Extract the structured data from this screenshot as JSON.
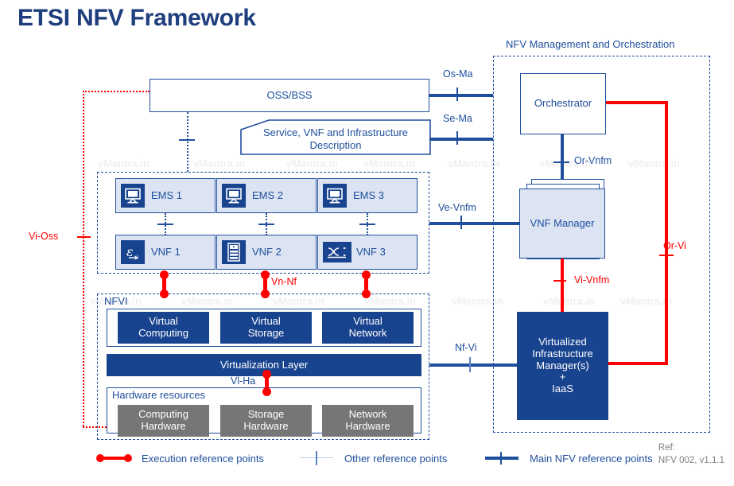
{
  "page": {
    "title": "ETSI NFV Framework",
    "watermark": "vMantra.in",
    "reference_note_line1": "Ref:",
    "reference_note_line2": "NFV 002, v1.1.1"
  },
  "colors": {
    "dark_blue": "#18438E",
    "title_blue": "#1F3E7E",
    "outline_blue": "#1F4E9C",
    "light_blue_fill": "#DCE4F3",
    "gray_fill": "#767676",
    "red": "#FF0000",
    "note_gray": "#7F7F7F"
  },
  "oss": {
    "label": "OSS/BSS"
  },
  "description_box": {
    "line1": "Service, VNF  and Infrastructure",
    "line2": "Description"
  },
  "vnf_layer": {
    "ems": [
      {
        "label": "EMS 1",
        "icon": "monitor-icon"
      },
      {
        "label": "EMS 2",
        "icon": "monitor-icon"
      },
      {
        "label": "EMS 3",
        "icon": "monitor-icon"
      }
    ],
    "vnfs": [
      {
        "label": "VNF 1",
        "icon": "epsilon-icon"
      },
      {
        "label": "VNF 2",
        "icon": "server-icon"
      },
      {
        "label": "VNF 3",
        "icon": "switch-icon"
      }
    ]
  },
  "nfvi": {
    "label": "NFVI",
    "virtual_resources": [
      {
        "line1": "Virtual",
        "line2": "Computing"
      },
      {
        "line1": "Virtual",
        "line2": "Storage"
      },
      {
        "line1": "Virtual",
        "line2": "Network"
      }
    ],
    "virtualization_layer": "Virtualization Layer",
    "hardware_label": "Hardware  resources",
    "hardware_resources": [
      {
        "line1": "Computing",
        "line2": "Hardware"
      },
      {
        "line1": "Storage",
        "line2": "Hardware"
      },
      {
        "line1": "Network",
        "line2": "Hardware"
      }
    ]
  },
  "mano": {
    "title": "NFV Management and Orchestration",
    "orchestrator": "Orchestrator",
    "vnf_manager": "VNF Manager",
    "vim_line1": "Virtualized",
    "vim_line2": "Infrastructure",
    "vim_line3": "Manager(s)",
    "vim_line4": "+",
    "vim_line5": "IaaS"
  },
  "reference_points": {
    "os_ma": "Os-Ma",
    "se_ma": "Se-Ma",
    "ve_vnfm": "Ve-Vnfm",
    "or_vnfm": "Or-Vnfm",
    "or_vi": "Or-Vi",
    "vi_vnfm": "Vi-Vnfm",
    "nf_vi": "Nf-Vi",
    "vn_nf": "Vn-Nf",
    "vi_ha": "Vl-Ha",
    "vi_oss": "Vi-Oss"
  },
  "legend": {
    "items": [
      {
        "label": "Execution reference points",
        "style": "execution"
      },
      {
        "label": "Other reference points",
        "style": "other"
      },
      {
        "label": "Main NFV reference points",
        "style": "main"
      }
    ]
  }
}
